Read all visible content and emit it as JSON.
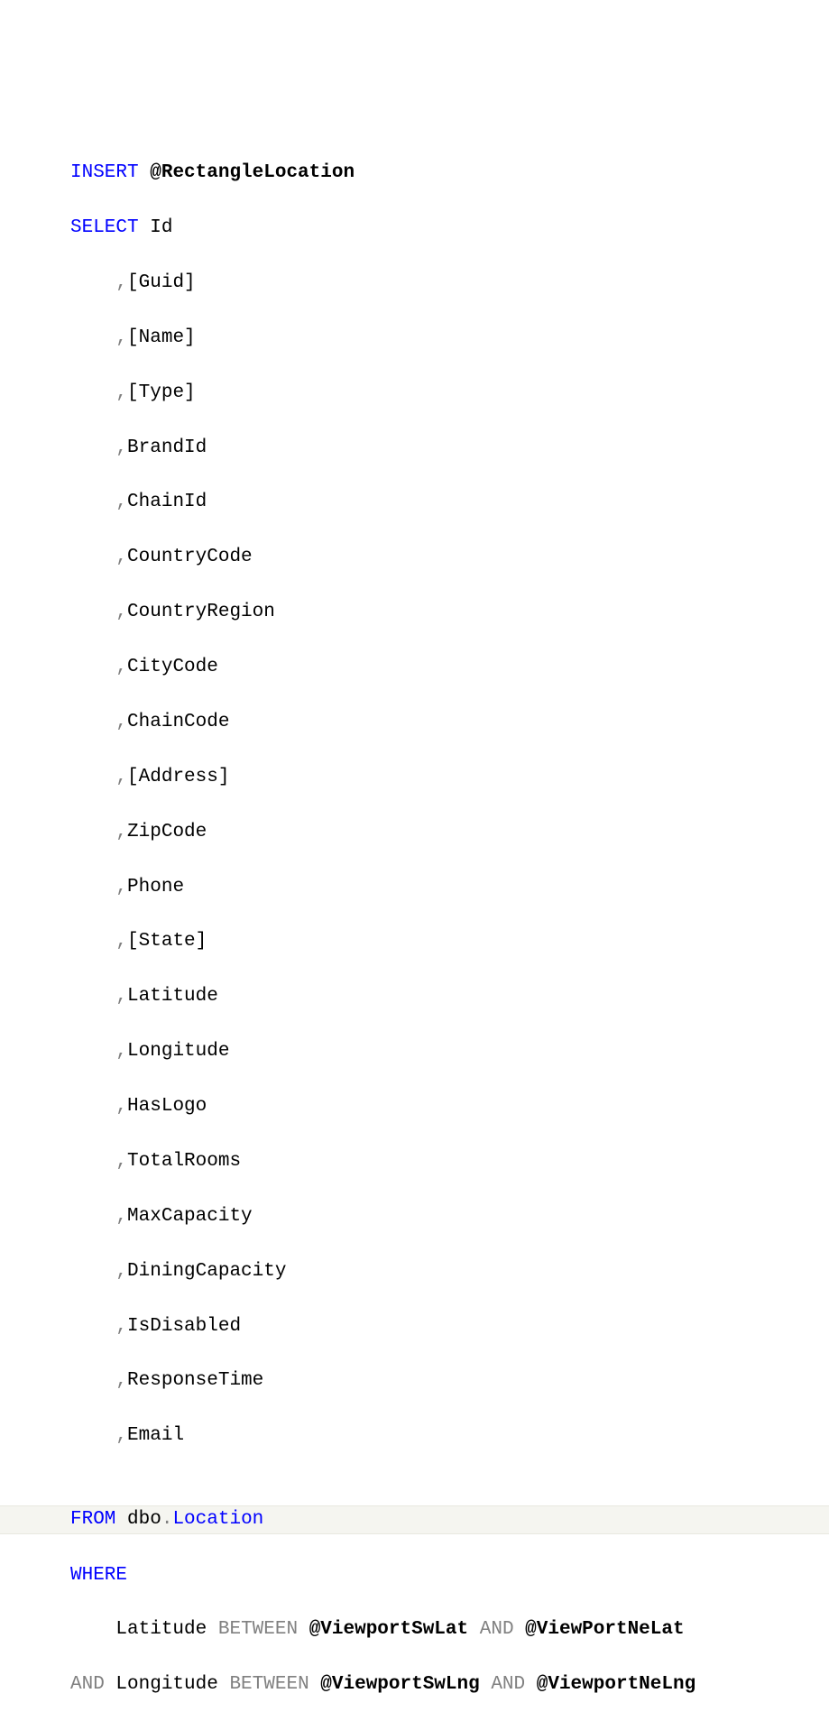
{
  "sql": {
    "insert_kw": "INSERT",
    "insert_var": "@RectangleLocation",
    "select_kw": "SELECT",
    "select_first": "Id",
    "columns": [
      "[Guid]",
      "[Name]",
      "[Type]",
      "BrandId",
      "ChainId",
      "CountryCode",
      "CountryRegion",
      "CityCode",
      "ChainCode",
      "[Address]",
      "ZipCode",
      "Phone",
      "[State]",
      "Latitude",
      "Longitude",
      "HasLogo",
      "TotalRooms",
      "MaxCapacity",
      "DiningCapacity",
      "IsDisabled",
      "ResponseTime",
      "Email"
    ],
    "from_kw": "FROM",
    "from_schema": "dbo",
    "from_dot": ".",
    "from_table": "Location",
    "where_kw": "WHERE",
    "where_line1_col": "Latitude",
    "where_line1_between": "BETWEEN",
    "where_line1_var1": "@ViewportSwLat",
    "where_line1_and": "AND",
    "where_line1_var2": "@ViewPortNeLat",
    "where_line2_and": "AND",
    "where_line2_col": "Longitude",
    "where_line2_between": "BETWEEN",
    "where_line2_var1": "@ViewportSwLng",
    "where_line2_and2": "AND",
    "where_line2_var2": "@ViewportNeLng"
  }
}
